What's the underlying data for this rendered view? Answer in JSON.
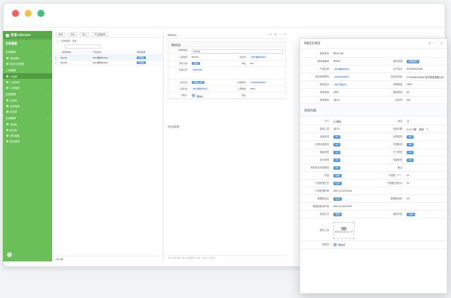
{
  "app": {
    "brand": "优速 Informat",
    "module": "仓库管理",
    "module_section": "仓库管理"
  },
  "colors": {
    "sidebar": "#6bbf59",
    "accent": "#5b9bd5",
    "dot_red": "#f25f5c",
    "dot_yellow": "#f5c04a",
    "dot_green": "#3cc47c"
  },
  "sidebar": {
    "groups": [
      {
        "label": "仓库基础",
        "items": [
          "仓库资料",
          "库存分布管理"
        ]
      },
      {
        "label": "入库管理",
        "items": [
          "入库单",
          "入库申请",
          "入库明细"
        ]
      },
      {
        "label": "出库管理",
        "items": [
          "出库单",
          "出库明细",
          "退货单"
        ]
      },
      {
        "label": "仓库管理",
        "items": [
          "领料库",
          "盘点库",
          "领料调度",
          "盘点管理"
        ]
      }
    ],
    "active_item": "入库单"
  },
  "list": {
    "toolbar": [
      "新增",
      "导出",
      "导入",
      "开 批量操作"
    ],
    "filter_label": "入库单编码 - 包含",
    "columns": [
      "入库单编码",
      "产品原料",
      "审核结果"
    ],
    "rows": [
      {
        "code": "RK001",
        "product": "002-物料RK001",
        "status": "已审核"
      },
      {
        "code": "RK002",
        "product": "002-物料RK002",
        "status": "已审核"
      }
    ],
    "footer": "2条记录"
  },
  "middle": {
    "title": "RK001",
    "section": "基础信息",
    "fields": [
      {
        "label": "入库单编码",
        "value": "RK001"
      },
      {
        "label": "入库编号",
        "value": "RK001",
        "label2": "供应商",
        "value2": "002-物料RK001"
      },
      {
        "label": "原料分类",
        "value": "原料",
        "label2": "单位",
        "value2": "001"
      },
      {
        "label": "检验记录",
        "value": "RKZJ-001"
      },
      {
        "label": "入库方式",
        "value": "采购入库",
        "label2": "采购单号",
        "value2": "CG2020120001"
      },
      {
        "label": "入库状态",
        "value": "002-物料RK001",
        "label2": "入库数量",
        "value2": "1000"
      },
      {
        "label": "创建人",
        "value": "曹钟杰",
        "label2": "备注",
        "value2": ""
      }
    ],
    "comment_label": "评论及变更",
    "comment_input": "输入评论内容，输入@提醒他人查看，shift+enter换行"
  },
  "detail": {
    "title": "RKZJ-001",
    "top": [
      [
        "质检单号",
        "RKZJ-001",
        "",
        ""
      ],
      [
        "原料单编号",
        "RK001",
        "原料类型",
        "采购物料"
      ],
      [
        "产品名称",
        "002-物料RK001",
        "生产批次",
        "SC2020112160"
      ],
      [
        "来料采购单号",
        "CG2020120001",
        "供应商信息",
        "GYS2020120001 电子贸易有限公司"
      ],
      [
        "原料批次",
        "001-产品001",
        "采购数量",
        "1000"
      ],
      [
        "来料数量",
        "1000",
        "抽检数量",
        "50"
      ],
      [
        "检验编号",
        "JQ-01",
        "检测号",
        "001"
      ]
    ],
    "section": "检验内容",
    "rows": [
      [
        "尺寸",
        "0.3毫米",
        "单位",
        "寸"
      ],
      [
        "检验工具",
        "JQ-01",
        "检验次数",
        "0-2-0.3毫",
        "检测",
        "1"
      ],
      [
        "包装检查",
        "OK",
        "标签检查",
        "OK"
      ],
      [
        "位置长度检查",
        "OK",
        "外观检查",
        "OK"
      ],
      [
        "重量检查",
        "OK",
        "尺寸检查",
        "OK"
      ],
      [
        "封口检查",
        "OK",
        "性能检查",
        "OK"
      ],
      [
        "来料是否有效期内",
        "OK",
        "备注",
        ""
      ],
      [
        "料盒",
        "合格",
        "不良数（个）",
        "11"
      ],
      [
        "不良处理方式",
        "让步",
        "不良数比例(%)",
        "11"
      ],
      [
        "不良处理时间",
        "2021-12-09 15:44",
        "",
        ""
      ],
      [
        "数据检验正",
        "让步",
        "数据检验时",
        "20"
      ],
      [
        "数据检验成时间",
        "2021-12-09 10:00",
        "",
        ""
      ],
      [
        "检验方式",
        "全检",
        "最终判定",
        "合格"
      ]
    ],
    "attachment_label": "附件上传",
    "upload_text": "拖拽到此处或点击上传",
    "inspector_label": "检验员",
    "inspector": "曹钟杰"
  }
}
